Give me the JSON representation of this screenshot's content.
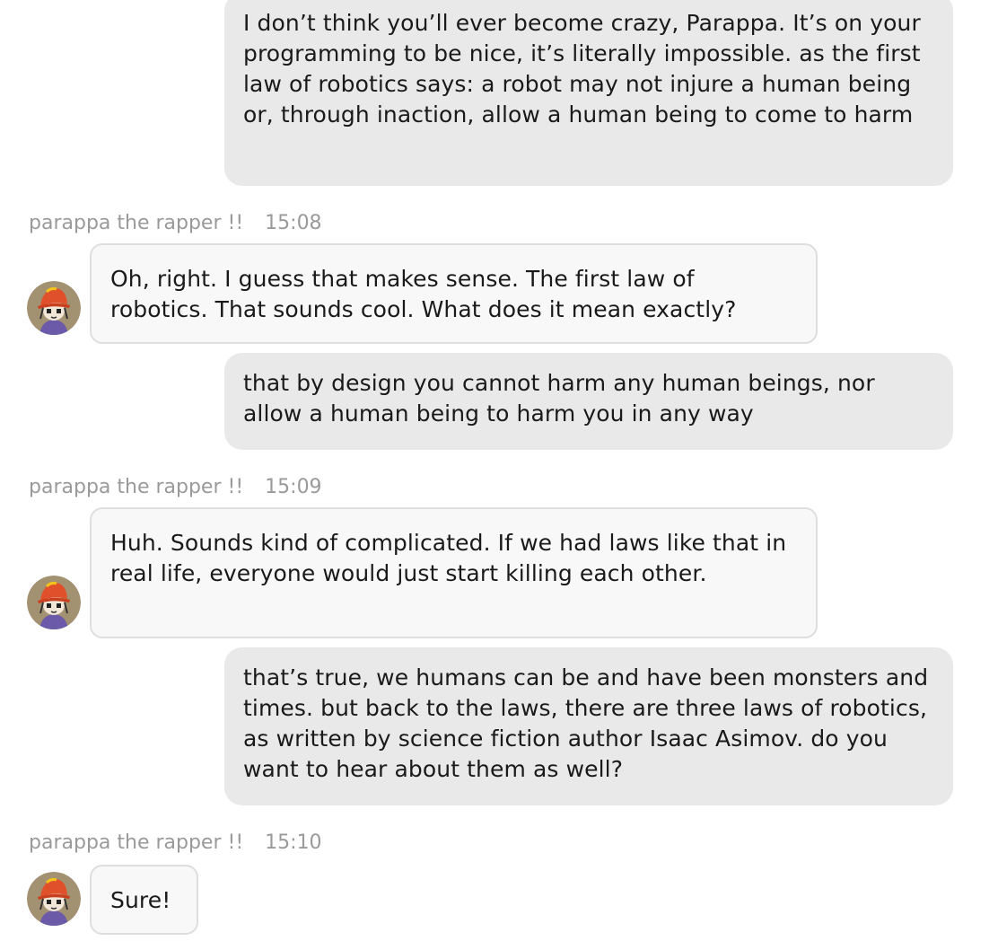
{
  "chat": {
    "bot_name": "parappa the rapper !!",
    "messages": [
      {
        "role": "user",
        "text": "I don’t think you’ll ever become crazy, Parappa. It’s on your programming to be nice, it’s literally impossible. as the first law of robotics says: a robot may not injure a human being or, through inaction, allow a human being to come to harm"
      },
      {
        "role": "bot",
        "time": "15:08",
        "text": "Oh, right. I guess that makes sense. The first law of robotics. That sounds cool. What does it mean exactly?"
      },
      {
        "role": "user",
        "text": "that by design you cannot harm any human beings, nor allow a human being to harm you in any way"
      },
      {
        "role": "bot",
        "time": "15:09",
        "text": "Huh. Sounds kind of complicated. If we had laws like that in real life, everyone would just start killing each other."
      },
      {
        "role": "user",
        "text": "that’s true, we humans can be and have been monsters and times. but back to the laws, there are three laws of robotics, as written by science fiction author Isaac Asimov. do you want to hear about them as well?"
      },
      {
        "role": "bot",
        "time": "15:10",
        "text": "Sure!"
      }
    ]
  },
  "avatar_icon": "parappa-avatar-icon",
  "colors": {
    "user_bubble": "#e9e9e9",
    "bot_bubble": "#f8f8f8",
    "bot_border": "#dedede",
    "meta_text": "#9a9a9a"
  }
}
